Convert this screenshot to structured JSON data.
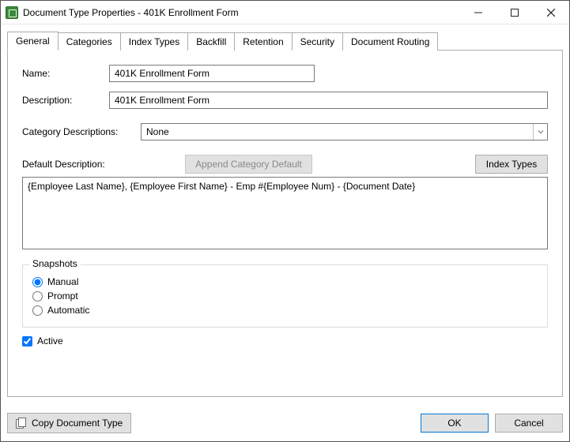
{
  "window": {
    "title": "Document Type Properties  - 401K Enrollment Form"
  },
  "tabs": [
    {
      "label": "General"
    },
    {
      "label": "Categories"
    },
    {
      "label": "Index Types"
    },
    {
      "label": "Backfill"
    },
    {
      "label": "Retention"
    },
    {
      "label": "Security"
    },
    {
      "label": "Document Routing"
    }
  ],
  "form": {
    "name_label": "Name:",
    "name_value": "401K Enrollment Form",
    "description_label": "Description:",
    "description_value": "401K Enrollment Form",
    "category_desc_label": "Category Descriptions:",
    "category_desc_value": "None",
    "default_desc_label": "Default Description:",
    "append_category_btn": "Append Category Default",
    "index_types_btn": "Index Types",
    "default_desc_value": "{Employee Last Name}, {Employee First Name} - Emp #{Employee Num} - {Document Date}",
    "snapshots": {
      "legend": "Snapshots",
      "options": [
        {
          "label": "Manual"
        },
        {
          "label": "Prompt"
        },
        {
          "label": "Automatic"
        }
      ],
      "selected": "Manual"
    },
    "active_label": "Active",
    "active_checked": true
  },
  "footer": {
    "copy_doc_label": "Copy Document Type",
    "ok_label": "OK",
    "cancel_label": "Cancel"
  }
}
